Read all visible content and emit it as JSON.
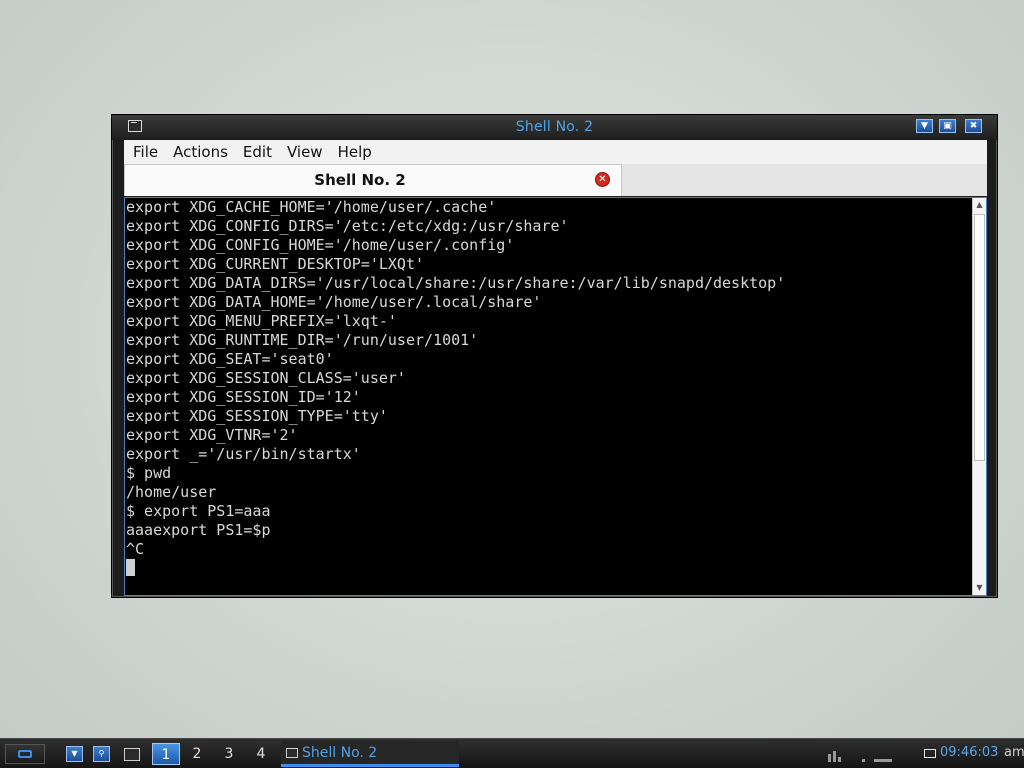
{
  "window": {
    "title": "Shell No. 2",
    "buttons": [
      "minimize",
      "maximize",
      "close"
    ]
  },
  "menubar": {
    "items": [
      "File",
      "Actions",
      "Edit",
      "View",
      "Help"
    ]
  },
  "tabs": [
    {
      "label": "Shell No. 2",
      "active": true
    }
  ],
  "terminal": {
    "lines": [
      "export XDG_CACHE_HOME='/home/user/.cache'",
      "export XDG_CONFIG_DIRS='/etc:/etc/xdg:/usr/share'",
      "export XDG_CONFIG_HOME='/home/user/.config'",
      "export XDG_CURRENT_DESKTOP='LXQt'",
      "export XDG_DATA_DIRS='/usr/local/share:/usr/share:/var/lib/snapd/desktop'",
      "export XDG_DATA_HOME='/home/user/.local/share'",
      "export XDG_MENU_PREFIX='lxqt-'",
      "export XDG_RUNTIME_DIR='/run/user/1001'",
      "export XDG_SEAT='seat0'",
      "export XDG_SESSION_CLASS='user'",
      "export XDG_SESSION_ID='12'",
      "export XDG_SESSION_TYPE='tty'",
      "export XDG_VTNR='2'",
      "export _='/usr/bin/startx'",
      "$ pwd",
      "/home/user",
      "$ export PS1=aaa",
      "aaaexport PS1=$p",
      "^C"
    ]
  },
  "taskbar": {
    "desktops": [
      "1",
      "2",
      "3",
      "4"
    ],
    "active_desktop": "1",
    "task_label": "Shell No. 2",
    "clock": "09:46:03",
    "ampm": "am"
  },
  "colors": {
    "accent": "#4fa3e8",
    "terminal_bg": "#000000",
    "terminal_fg": "#d8d8d8",
    "close_red": "#d42a1e"
  }
}
